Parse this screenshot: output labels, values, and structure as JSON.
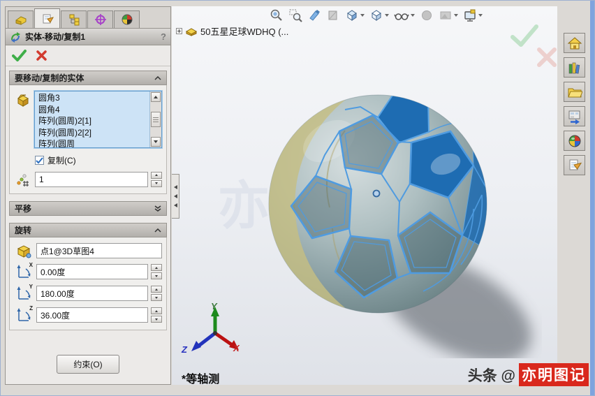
{
  "axis": {
    "x": "X",
    "y": "Y",
    "z": "Z"
  },
  "pm": {
    "tabs": [
      "featuremanager",
      "propertymanager",
      "configurationmanager",
      "dimxpertmanager",
      "displaymanager"
    ],
    "active_tab": "propertymanager",
    "title": "实体-移动/复制1",
    "help_label": "?",
    "bodies": {
      "header": "要移动/复制的实体",
      "items": [
        "圆角3",
        "圆角4",
        "阵列(圆周)2[1]",
        "阵列(圆周)2[2]",
        "阵列(圆周"
      ],
      "copy_label": "复制(C)",
      "copy_checked": true,
      "copies": "1"
    },
    "translate": {
      "header": "平移",
      "collapsed": true
    },
    "rotate": {
      "header": "旋转",
      "point": "点1@3D草图4",
      "x": "0.00度",
      "y": "180.00度",
      "z": "36.00度"
    },
    "constrain": "约束(O)"
  },
  "vp": {
    "heads_up_toolbar": [
      "zoom-to-fit",
      "zoom-to-area",
      "previous-view",
      "section-view",
      "view-orientation",
      "display-style",
      "hide-show-items",
      "edit-appearance",
      "apply-scene",
      "view-settings"
    ],
    "tree_root": "50五星足球WDHQ  (...",
    "view_label": "*等轴测",
    "watermark": "亦"
  },
  "tp": {
    "tabs": [
      "home",
      "design-library",
      "file-explorer",
      "view-palette",
      "appearances",
      "custom-properties"
    ]
  },
  "brand": {
    "prefix": "头条 @",
    "highlight": "亦明图记"
  },
  "colors": {
    "wireframe_blue": "#4f9be0",
    "solid_face_blue": "#1e6cb2",
    "body_khaki": "#c6be83",
    "selection_blue": "#cde3f6",
    "confirm_green": "#3fae49",
    "cancel_red": "#d23b2f",
    "brand_red": "#d9281c"
  }
}
